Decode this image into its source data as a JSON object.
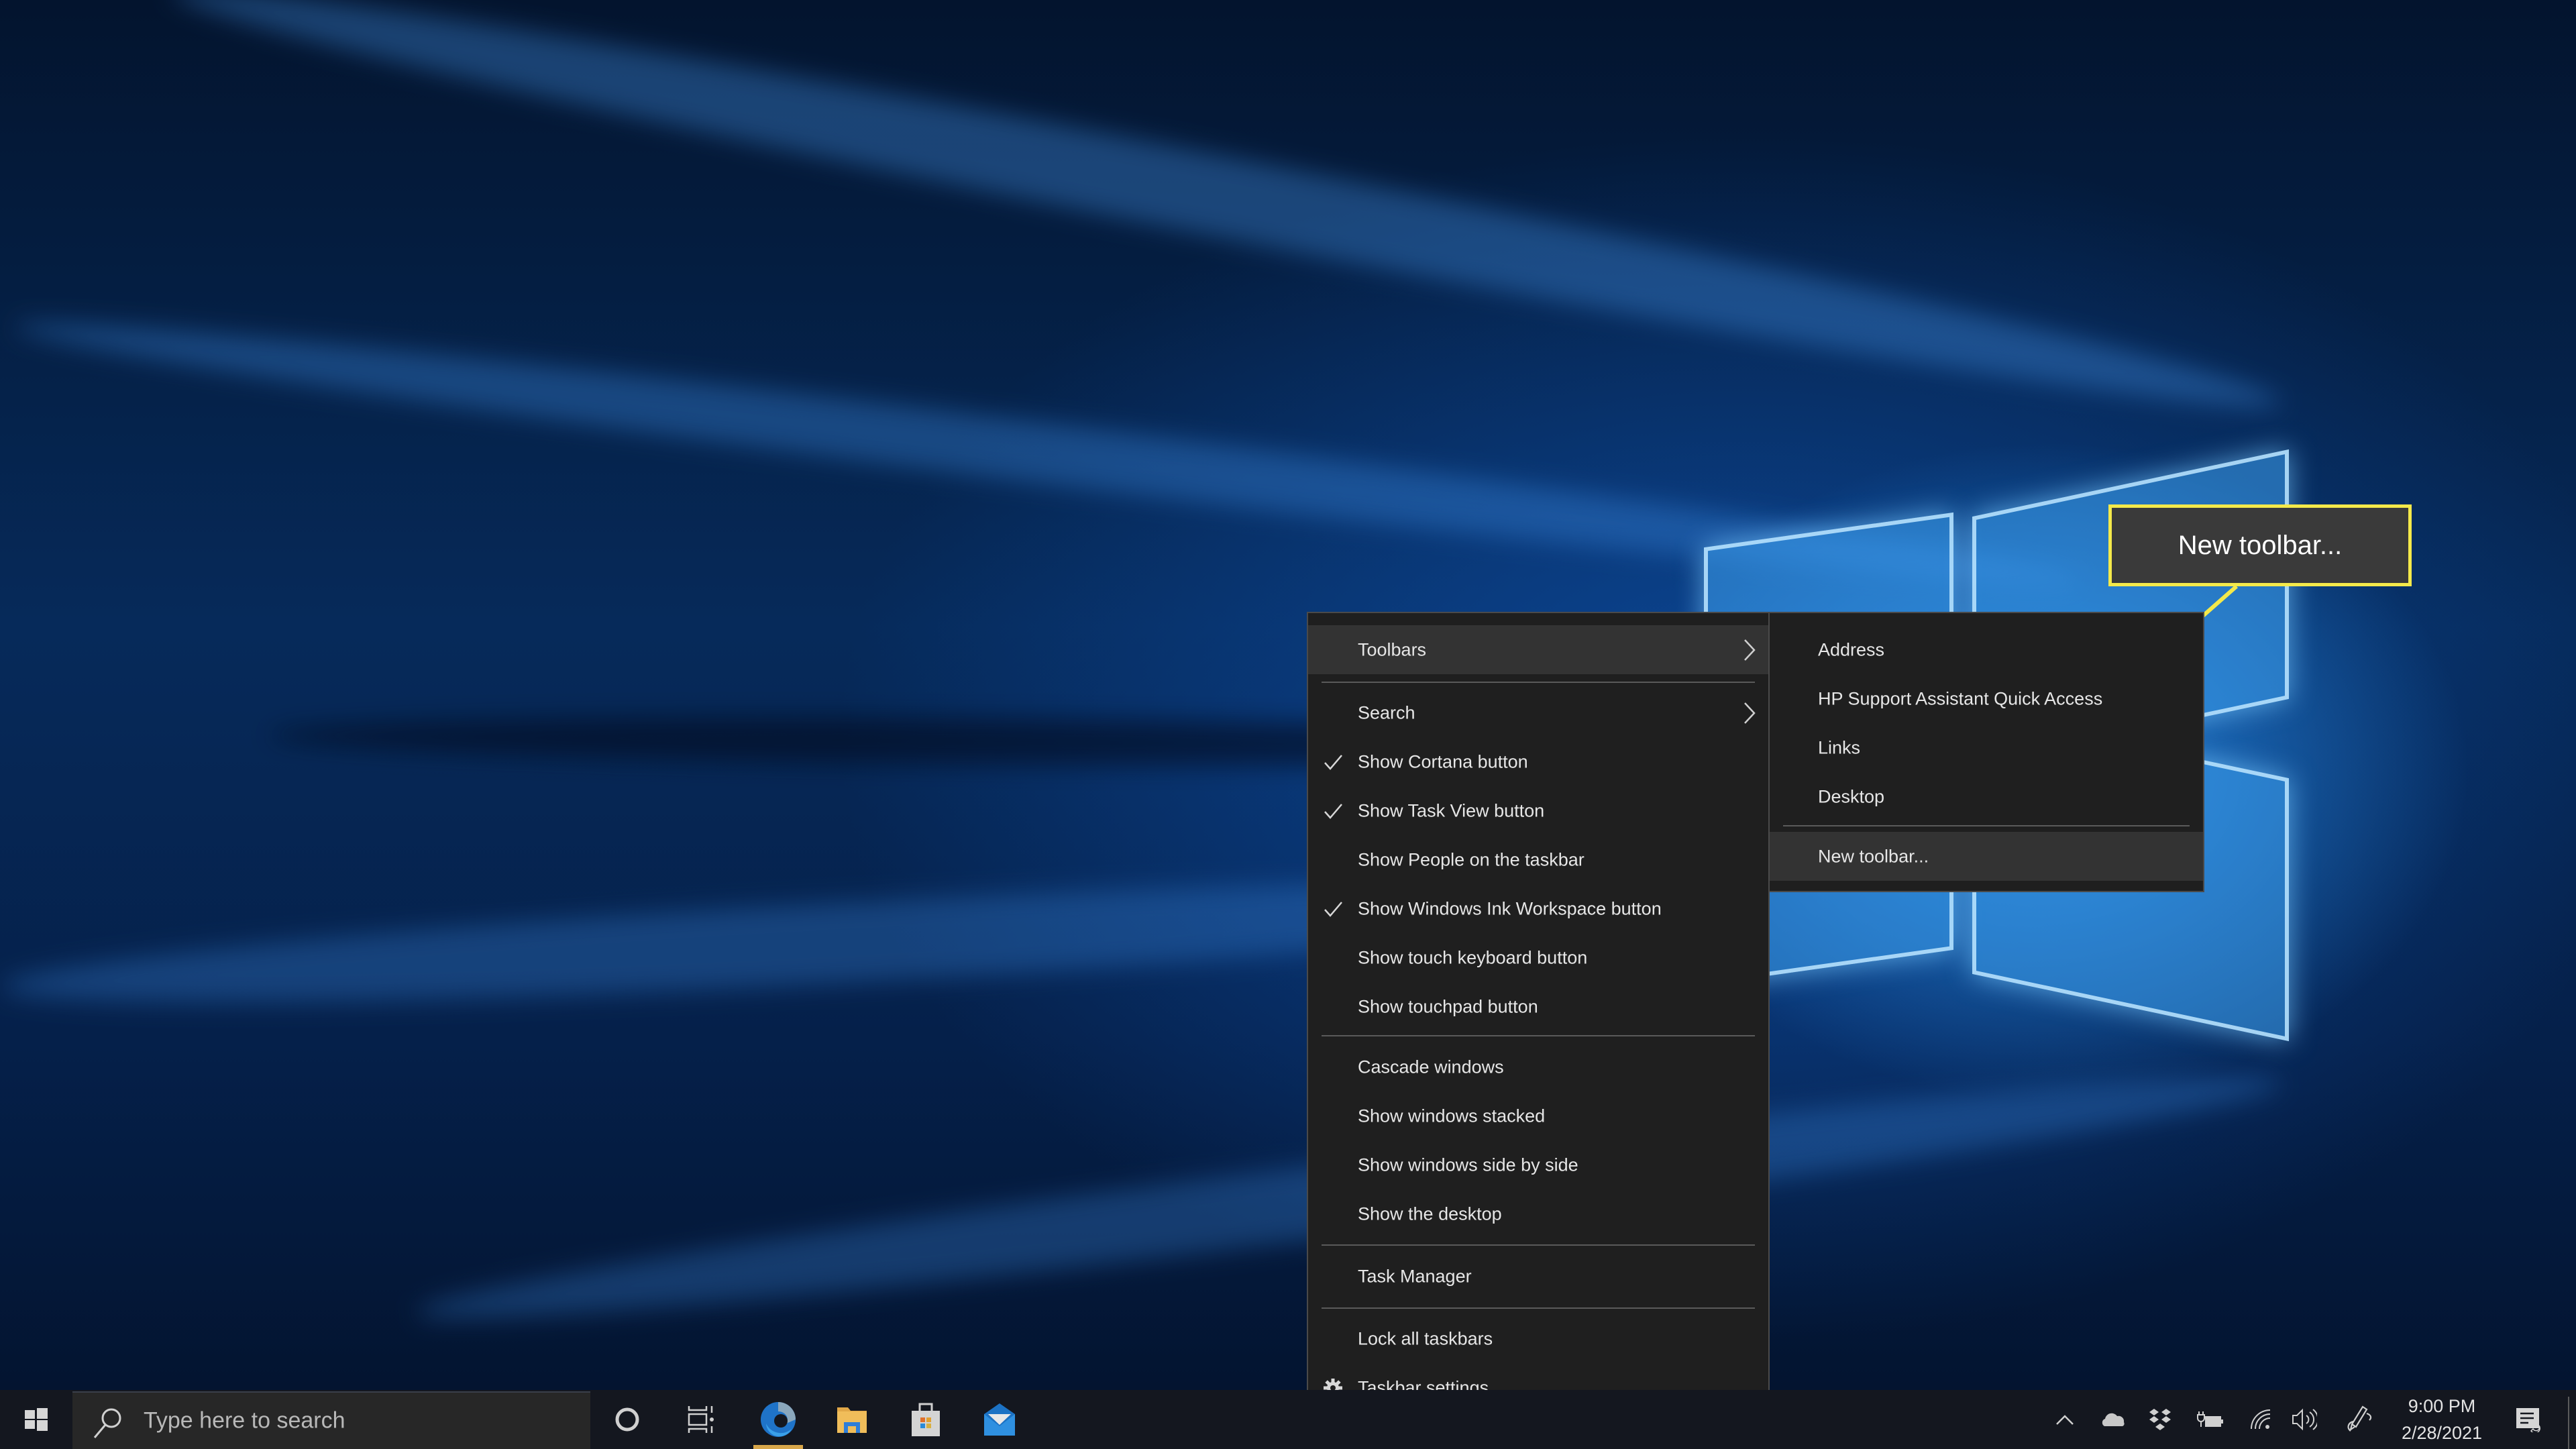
{
  "context_menu": {
    "items": [
      {
        "label": "Toolbars",
        "checked": false,
        "submenu": true,
        "highlighted": true
      },
      {
        "label": "Search",
        "checked": false,
        "submenu": true
      },
      {
        "label": "Show Cortana button",
        "checked": true
      },
      {
        "label": "Show Task View button",
        "checked": true
      },
      {
        "label": "Show People on the taskbar",
        "checked": false
      },
      {
        "label": "Show Windows Ink Workspace button",
        "checked": true
      },
      {
        "label": "Show touch keyboard button",
        "checked": false
      },
      {
        "label": "Show touchpad button",
        "checked": false
      },
      {
        "label": "Cascade windows"
      },
      {
        "label": "Show windows stacked"
      },
      {
        "label": "Show windows side by side"
      },
      {
        "label": "Show the desktop"
      },
      {
        "label": "Task Manager"
      },
      {
        "label": "Lock all taskbars"
      },
      {
        "label": "Taskbar settings",
        "icon": "gear-icon"
      }
    ]
  },
  "toolbars_submenu": {
    "items": [
      {
        "label": "Address"
      },
      {
        "label": "HP Support Assistant Quick Access"
      },
      {
        "label": "Links"
      },
      {
        "label": "Desktop"
      },
      {
        "label": "New toolbar...",
        "highlighted": true
      }
    ]
  },
  "callout": {
    "text": "New toolbar...",
    "border_color": "#f4e94a"
  },
  "taskbar": {
    "search_placeholder": "Type here to search",
    "pinned_apps": [
      {
        "name": "Cortana",
        "icon": "cortana-icon"
      },
      {
        "name": "Task View",
        "icon": "task-view-icon"
      },
      {
        "name": "Microsoft Edge",
        "icon": "edge-icon",
        "active": true
      },
      {
        "name": "File Explorer",
        "icon": "file-explorer-icon"
      },
      {
        "name": "Microsoft Store",
        "icon": "store-icon"
      },
      {
        "name": "Mail",
        "icon": "mail-icon"
      }
    ],
    "tray_icons": [
      "chevron-up-icon",
      "onedrive-icon",
      "dropbox-icon",
      "battery-charging-icon",
      "wifi-icon",
      "volume-icon",
      "windows-ink-icon"
    ],
    "time": "9:00 PM",
    "date": "2/28/2021"
  },
  "colors": {
    "menu_bg": "#1f1f1f",
    "menu_highlight": "#333333",
    "taskbar_bg": "#14171f",
    "accent_yellow": "#f4e94a"
  }
}
